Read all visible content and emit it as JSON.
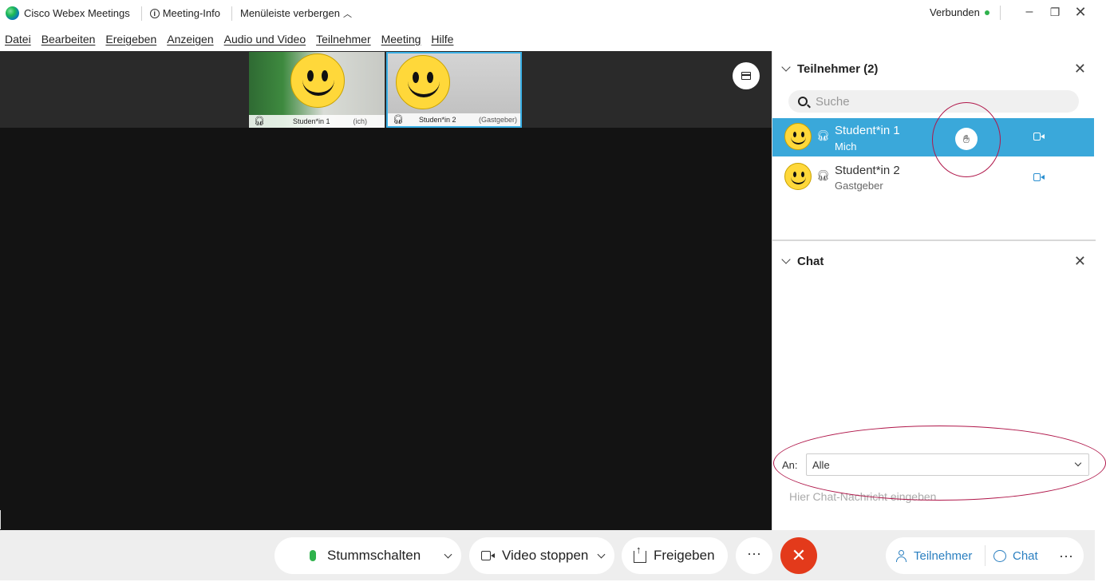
{
  "titlebar": {
    "app_title": "Cisco Webex Meetings",
    "meeting_info": "Meeting-Info",
    "hide_menu": "Menüleiste verbergen",
    "status": "Verbunden",
    "status_color": "#2fb24c"
  },
  "menubar": {
    "items": [
      "Datei",
      "Bearbeiten",
      "Ereigeben",
      "Anzeigen",
      "Audio und Video",
      "Teilnehmer",
      "Meeting",
      "Hilfe"
    ]
  },
  "stage": {
    "thumbnails": [
      {
        "name": "Studen*in 1",
        "role": "(ich)"
      },
      {
        "name": "Studen*in 2",
        "role": "(Gastgeber)"
      }
    ]
  },
  "participants_panel": {
    "title": "Teilnehmer (2)",
    "search_placeholder": "Suche",
    "participants": [
      {
        "name": "Student*in 1",
        "role": "Mich",
        "selected": true,
        "hand_raised": true
      },
      {
        "name": "Student*in 2",
        "role": "Gastgeber",
        "selected": false,
        "hand_raised": false
      }
    ]
  },
  "chat_panel": {
    "title": "Chat",
    "to_label": "An:",
    "to_value": "Alle",
    "input_placeholder": "Hier Chat-Nachricht eingeben"
  },
  "bottombar": {
    "mute_label": "Stummschalten",
    "video_label": "Video stoppen",
    "share_label": "Freigeben",
    "more_label": "···",
    "participants_label": "Teilnehmer",
    "chat_label": "Chat",
    "end_color": "#e33a1b",
    "accent_color": "#2a7fc0"
  },
  "icons": [
    "webex-logo",
    "info-icon",
    "chevron-up-icon",
    "minimize-icon",
    "restore-icon",
    "close-icon",
    "layout-icon",
    "search-icon",
    "headset-icon",
    "raise-hand-icon",
    "video-icon",
    "microphone-icon",
    "share-icon",
    "more-icon",
    "end-call-icon",
    "person-icon",
    "chat-bubble-icon"
  ]
}
